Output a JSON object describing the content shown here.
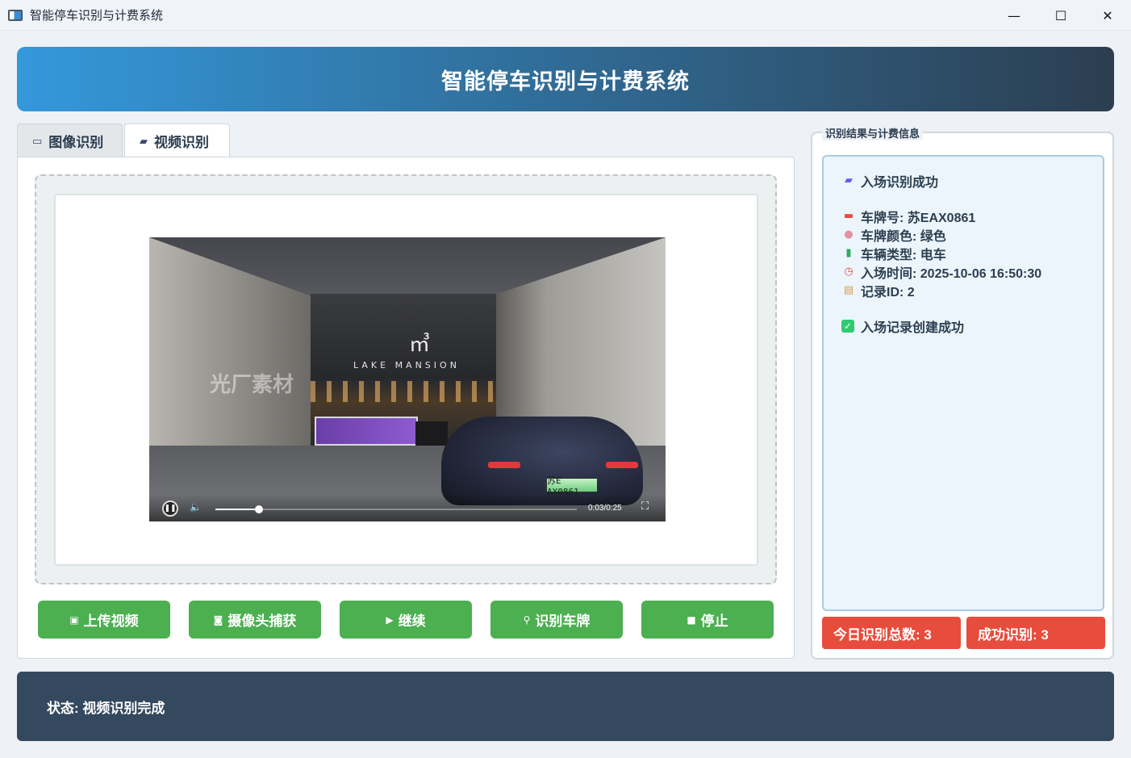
{
  "window": {
    "title": "智能停车识别与计费系统",
    "controls": {
      "minimize": "—",
      "maximize": "☐",
      "close": "✕"
    }
  },
  "header": {
    "title": "智能停车识别与计费系统"
  },
  "tabs": [
    {
      "label": "图像识别",
      "icon": "camera-icon",
      "active": false
    },
    {
      "label": "视频识别",
      "icon": "video-camera-icon",
      "active": true
    }
  ],
  "video": {
    "logo": "㎥",
    "brand": "LAKE MANSION",
    "watermark": "光厂素材",
    "plate": "苏E AX0861",
    "time": "0:03/0:25",
    "progress": 0.12,
    "state": "playing"
  },
  "buttons": [
    {
      "label": "上传视频",
      "icon": "upload-video-icon",
      "glyph": "▣"
    },
    {
      "label": "摄像头捕获",
      "icon": "camera-icon",
      "glyph": "◙"
    },
    {
      "label": "继续",
      "icon": "play-icon",
      "glyph": "▶"
    },
    {
      "label": "识别车牌",
      "icon": "magnifier-icon",
      "glyph": "⚲"
    },
    {
      "label": "停止",
      "icon": "stop-icon",
      "glyph": "■"
    }
  ],
  "results": {
    "group_title": "识别结果与计费信息",
    "heading": "入场识别成功",
    "plate_line": "车牌号: 苏EAX0861",
    "color_line": "车牌颜色: 绿色",
    "type_line": "车辆类型: 电车",
    "time_line": "入场时间: 2025-10-06 16:50:30",
    "id_line": "记录ID: 2",
    "record_line": "入场记录创建成功"
  },
  "stats": {
    "total": "今日识别总数: 3",
    "success": "成功识别: 3"
  },
  "status": {
    "text": "状态: 视频识别完成"
  },
  "colors": {
    "header_start": "#3498db",
    "header_end": "#2c3e50",
    "button_green": "#4caf50",
    "stat_red": "#e74c3c",
    "status_bg": "#34495e",
    "result_bg": "#ebf5fb"
  }
}
